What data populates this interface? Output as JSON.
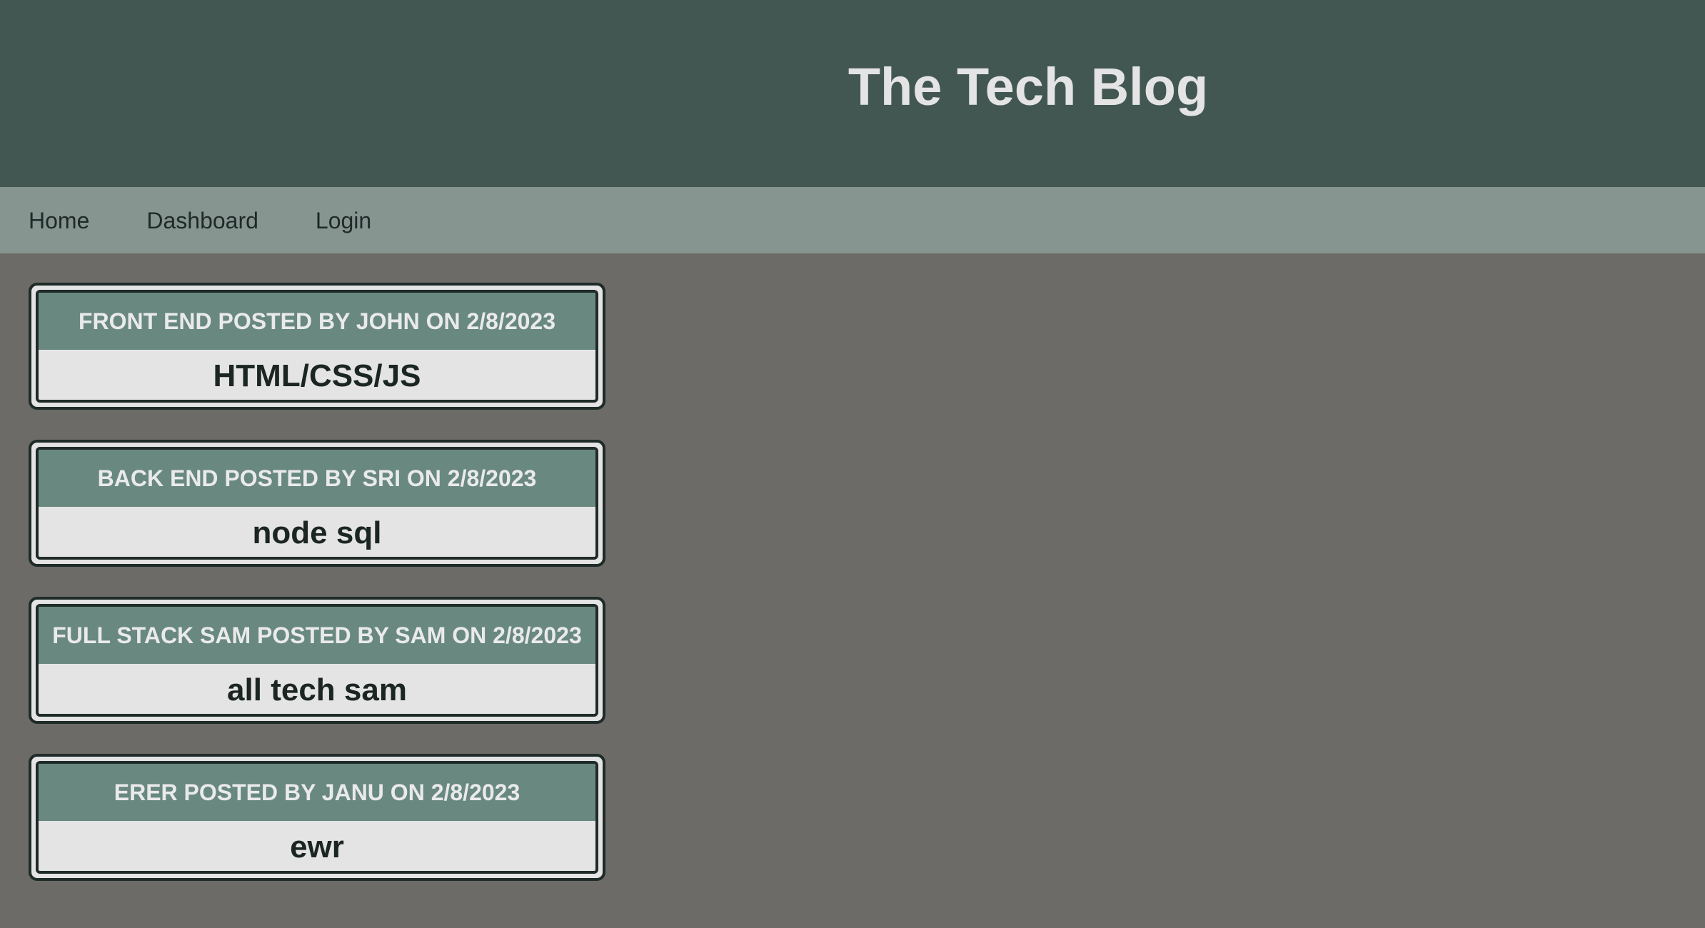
{
  "header": {
    "title": "The Tech Blog"
  },
  "nav": {
    "items": [
      {
        "label": "Home"
      },
      {
        "label": "Dashboard"
      },
      {
        "label": "Login"
      }
    ]
  },
  "posts": [
    {
      "header": "FRONT END POSTED BY JOHN ON 2/8/2023",
      "body": "HTML/CSS/JS"
    },
    {
      "header": "BACK END POSTED BY SRI ON 2/8/2023",
      "body": "node sql"
    },
    {
      "header": "FULL STACK SAM POSTED BY SAM ON 2/8/2023",
      "body": "all tech sam"
    },
    {
      "header": "ERER POSTED BY JANU ON 2/8/2023",
      "body": "ewr"
    }
  ],
  "colors": {
    "header_bg": "#425752",
    "nav_bg": "#879591",
    "page_bg": "#6c6b67",
    "post_header_bg": "#688880",
    "post_body_bg": "#e4e4e4"
  }
}
